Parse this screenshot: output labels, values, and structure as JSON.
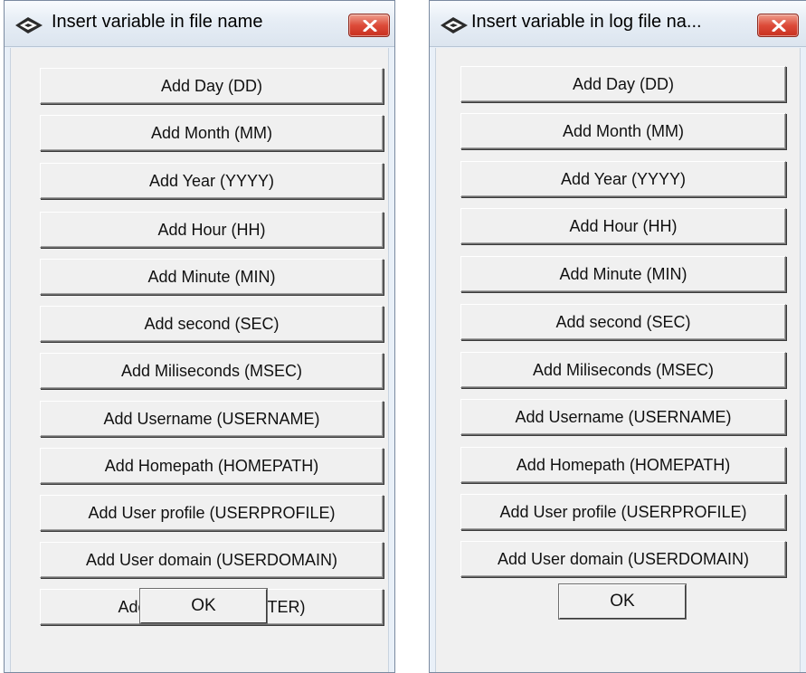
{
  "dialogs": [
    {
      "title": "Insert variable in file name",
      "buttons": [
        "Add Day (DD)",
        "Add Month (MM)",
        "Add Year (YYYY)",
        "Add Hour (HH)",
        "Add Minute (MIN)",
        "Add second (SEC)",
        "Add Miliseconds (MSEC)",
        "Add Username (USERNAME)",
        "Add Homepath (HOMEPATH)",
        "Add User profile (USERPROFILE)",
        "Add User domain (USERDOMAIN)",
        "Add Counter (COUNTER)"
      ],
      "ok_label": "OK"
    },
    {
      "title": "Insert variable in log file na...",
      "buttons": [
        "Add Day (DD)",
        "Add Month (MM)",
        "Add Year (YYYY)",
        "Add Hour (HH)",
        "Add Minute (MIN)",
        "Add second (SEC)",
        "Add Miliseconds (MSEC)",
        "Add Username (USERNAME)",
        "Add Homepath (HOMEPATH)",
        "Add User profile (USERPROFILE)",
        "Add User domain (USERDOMAIN)"
      ],
      "ok_label": "OK"
    }
  ],
  "icons": {
    "app": "app-logo-icon",
    "close": "close-icon"
  },
  "colors": {
    "close_button": "#dd4b39",
    "title_bar": "#e6edf5",
    "dialog_face": "#f0f0f0"
  }
}
